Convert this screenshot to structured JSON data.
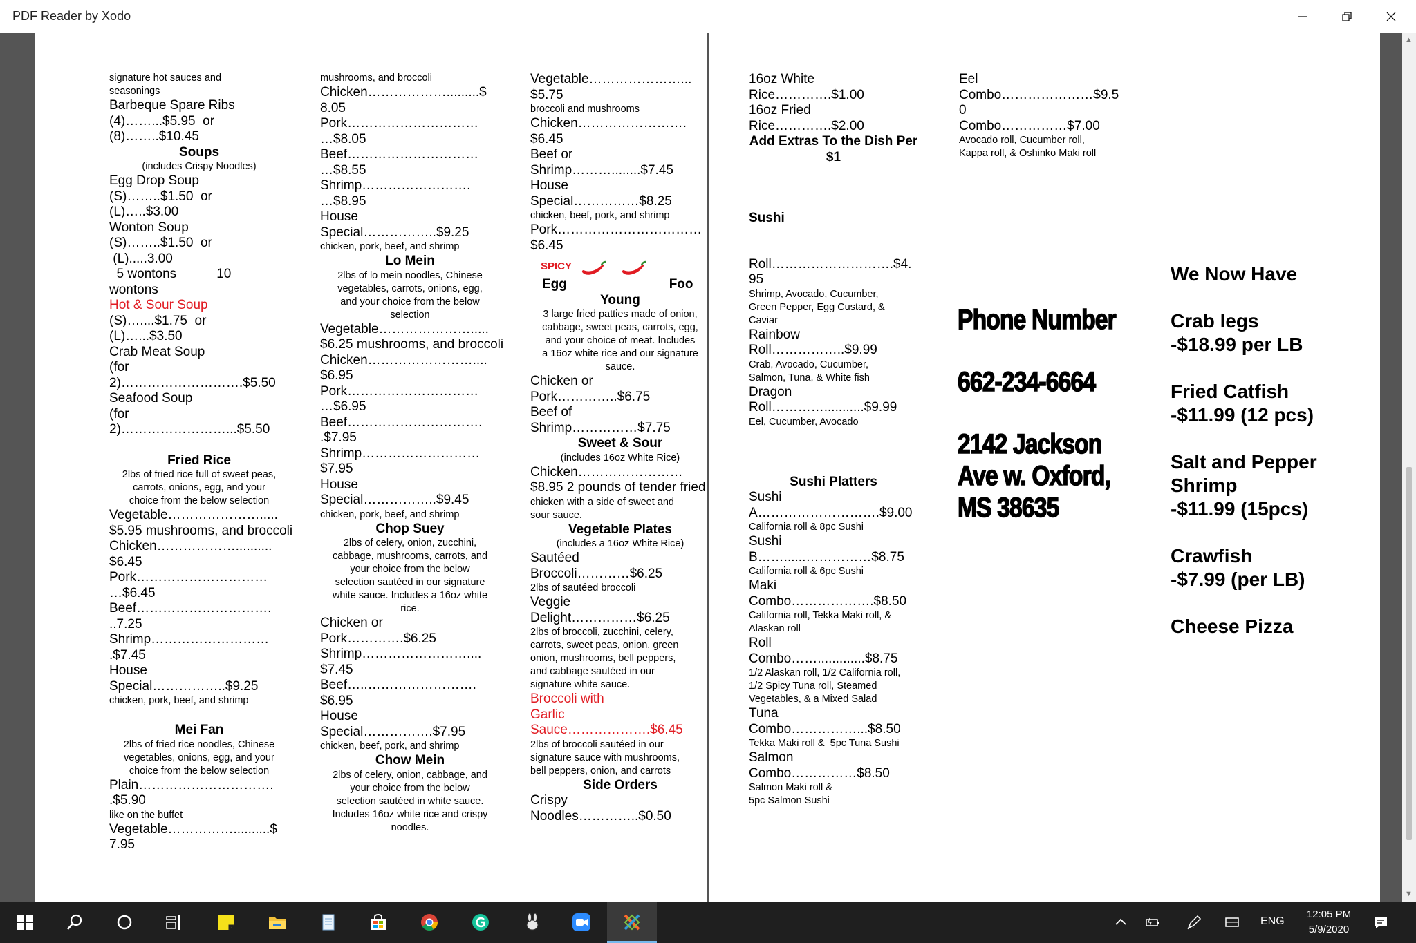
{
  "window": {
    "title": "PDF Reader by Xodo"
  },
  "left_page": {
    "col1": [
      [
        "s",
        "signature hot sauces and"
      ],
      [
        "s",
        "seasonings"
      ],
      [
        "n",
        "Barbeque Spare Ribs"
      ],
      [
        "n",
        "(4)……...$5.95  or"
      ],
      [
        "n",
        "(8)……..$10.45"
      ],
      [
        "h",
        "Soups"
      ],
      [
        "sc",
        "(includes Crispy Noodles)"
      ],
      [
        "n",
        "Egg Drop Soup"
      ],
      [
        "n",
        "(S)……..$1.50  or"
      ],
      [
        "n",
        "(L)…..$3.00"
      ],
      [
        "n",
        "Wonton Soup"
      ],
      [
        "n",
        "(S)……..$1.50  or"
      ],
      [
        "n",
        " (L).....3.00"
      ],
      [
        "n",
        "  5 wontons           10"
      ],
      [
        "n",
        "wontons"
      ],
      [
        "r",
        "Hot & Sour Soup"
      ],
      [
        "n",
        "(S)…....$1.75  or"
      ],
      [
        "n",
        "(L)…...$3.50"
      ],
      [
        "n",
        "Crab Meat Soup"
      ],
      [
        "n",
        "(for"
      ],
      [
        "n",
        "2)……………………….$5.50"
      ],
      [
        "n",
        "Seafood Soup"
      ],
      [
        "n",
        "(for"
      ],
      [
        "n",
        "2)……………………...$5.50"
      ],
      [
        "gap",
        ""
      ],
      [
        "h",
        "Fried Rice"
      ],
      [
        "sc",
        "2lbs of fried rice full of sweet peas,"
      ],
      [
        "sc",
        "carrots, onions, egg, and your"
      ],
      [
        "sc",
        "choice from the below selection"
      ],
      [
        "n",
        "Vegetable…………………....."
      ],
      [
        "n",
        "$5.95 mushrooms, and broccoli"
      ],
      [
        "n",
        "Chicken……………….........."
      ],
      [
        "n",
        "$6.45"
      ],
      [
        "n",
        "Pork…………………………"
      ],
      [
        "n",
        "…$6.45"
      ],
      [
        "n",
        "Beef…………………………."
      ],
      [
        "n",
        "..7.25"
      ],
      [
        "n",
        "Shrimp………………………"
      ],
      [
        "n",
        ".$7.45"
      ],
      [
        "n",
        "House"
      ],
      [
        "n",
        "Special……………..$9.25"
      ],
      [
        "s",
        "chicken, pork, beef, and shrimp"
      ],
      [
        "gap",
        ""
      ],
      [
        "h",
        "Mei Fan"
      ],
      [
        "sc",
        "2lbs of fried rice noodles, Chinese"
      ],
      [
        "sc",
        "vegetables, onions, egg, and your"
      ],
      [
        "sc",
        "choice from the below selection"
      ],
      [
        "n",
        "Plain…………………………."
      ],
      [
        "n",
        ".$5.90"
      ],
      [
        "s",
        "like on the buffet"
      ],
      [
        "n",
        "Vegetable……………..........$"
      ],
      [
        "n",
        "7.95"
      ]
    ],
    "col2": [
      [
        "s",
        "mushrooms, and broccoli"
      ],
      [
        "n",
        "Chicken……………….........$"
      ],
      [
        "n",
        "8.05"
      ],
      [
        "n",
        "Pork…………………………"
      ],
      [
        "n",
        "…$8.05"
      ],
      [
        "n",
        "Beef…………………………"
      ],
      [
        "n",
        "…$8.55"
      ],
      [
        "n",
        "Shrimp……………………."
      ],
      [
        "n",
        "…$8.95"
      ],
      [
        "n",
        "House"
      ],
      [
        "n",
        "Special……………..$9.25"
      ],
      [
        "s",
        "chicken, pork, beef, and shrimp"
      ],
      [
        "h",
        "Lo Mein"
      ],
      [
        "sc",
        "2lbs of lo mein noodles, Chinese"
      ],
      [
        "sc",
        "vegetables, carrots, onions, egg,"
      ],
      [
        "sc",
        "and your choice from the below"
      ],
      [
        "sc",
        "selection"
      ],
      [
        "n",
        "Vegetable…………………....."
      ],
      [
        "n",
        "$6.25 mushrooms, and broccoli"
      ],
      [
        "n",
        "Chicken……………………...."
      ],
      [
        "n",
        "$6.95"
      ],
      [
        "n",
        "Pork…………………………"
      ],
      [
        "n",
        "…$6.95"
      ],
      [
        "n",
        "Beef…………………………."
      ],
      [
        "n",
        ".$7.95"
      ],
      [
        "n",
        "Shrimp………………………"
      ],
      [
        "n",
        "$7.95"
      ],
      [
        "n",
        "House"
      ],
      [
        "n",
        "Special……………..$9.45"
      ],
      [
        "s",
        "chicken, pork, beef, and shrimp"
      ],
      [
        "h",
        "Chop Suey"
      ],
      [
        "sc",
        "2lbs of celery, onion, zucchini,"
      ],
      [
        "sc",
        "cabbage, mushrooms, carrots, and"
      ],
      [
        "sc",
        "your choice from the below"
      ],
      [
        "sc",
        "selection sautéed in our signature"
      ],
      [
        "sc",
        "white sauce. Includes a 16oz white"
      ],
      [
        "sc",
        "rice."
      ],
      [
        "n",
        "Chicken or"
      ],
      [
        "n",
        "Pork………….$6.25"
      ],
      [
        "n",
        "Shrimp……………………...."
      ],
      [
        "n",
        "$7.45"
      ],
      [
        "n",
        "Beef…..……………………."
      ],
      [
        "n",
        "$6.95"
      ],
      [
        "n",
        "House"
      ],
      [
        "n",
        "Special…………….$7.95"
      ],
      [
        "s",
        "chicken, beef, pork, and shrimp"
      ],
      [
        "h",
        "Chow Mein"
      ],
      [
        "sc",
        "2lbs of celery, onion, cabbage, and"
      ],
      [
        "sc",
        "your choice from the below"
      ],
      [
        "sc",
        "selection sautéed in white sauce."
      ],
      [
        "sc",
        "Includes 16oz white rice and crispy"
      ],
      [
        "sc",
        "noodles."
      ]
    ],
    "col3_top": [
      [
        "n",
        "Vegetable…………………..."
      ],
      [
        "n",
        "$5.75"
      ],
      [
        "s",
        "broccoli and mushrooms"
      ],
      [
        "n",
        "Chicken……………………."
      ],
      [
        "n",
        "$6.45"
      ],
      [
        "n",
        "Beef or"
      ],
      [
        "n",
        "Shrimp………........$7.45"
      ],
      [
        "n",
        "House"
      ],
      [
        "n",
        "Special……………$8.25"
      ],
      [
        "s",
        "chicken, beef, pork, and shrimp"
      ],
      [
        "n",
        "Pork……………………………"
      ],
      [
        "n",
        "$6.45"
      ]
    ],
    "spicy_label": "SPICY",
    "egg_foo_line": "Egg                            Foo",
    "col3_bottom": [
      [
        "h",
        "Young"
      ],
      [
        "sc",
        "3 large fried patties made of onion,"
      ],
      [
        "sc",
        "cabbage, sweet peas, carrots, egg,"
      ],
      [
        "sc",
        "and your choice of meat. Includes"
      ],
      [
        "sc",
        "a 16oz white rice and our signature"
      ],
      [
        "sc",
        "sauce."
      ],
      [
        "n",
        "Chicken or"
      ],
      [
        "n",
        "Pork…………..$6.75"
      ],
      [
        "n",
        "Beef of"
      ],
      [
        "n",
        "Shrimp……………$7.75"
      ],
      [
        "h",
        "Sweet & Sour"
      ],
      [
        "sc",
        "(includes 16oz White Rice)"
      ],
      [
        "n",
        "Chicken……………………"
      ],
      [
        "n",
        "$8.95 2 pounds of tender fried"
      ],
      [
        "s",
        "chicken with a side of sweet and"
      ],
      [
        "s",
        "sour sauce."
      ],
      [
        "h",
        "Vegetable Plates"
      ],
      [
        "sc",
        "(includes a 16oz White Rice)"
      ],
      [
        "n",
        "Sautéed"
      ],
      [
        "n",
        "Broccoli…………$6.25"
      ],
      [
        "s",
        "2lbs of sautéed broccoli"
      ],
      [
        "n",
        "Veggie"
      ],
      [
        "n",
        "Delight……………$6.25"
      ],
      [
        "s",
        "2lbs of broccoli, zucchini, celery,"
      ],
      [
        "s",
        "carrots, sweet peas, onion, green"
      ],
      [
        "s",
        "onion, mushrooms, bell peppers,"
      ],
      [
        "s",
        "and cabbage sautéed in our"
      ],
      [
        "s",
        "signature white sauce."
      ],
      [
        "r",
        "Broccoli with"
      ],
      [
        "r",
        "Garlic"
      ],
      [
        "rn",
        "Sauce……………….$6.45"
      ],
      [
        "s",
        "2lbs of broccoli sautéed in our"
      ],
      [
        "s",
        "signature sauce with mushrooms,"
      ],
      [
        "s",
        "bell peppers, onion, and carrots"
      ],
      [
        "h",
        "Side Orders"
      ],
      [
        "n",
        "Crispy"
      ],
      [
        "n",
        "Noodles…………..$0.50"
      ]
    ]
  },
  "right_page": {
    "col4": [
      [
        "n",
        "16oz White"
      ],
      [
        "n",
        "Rice………….$1.00"
      ],
      [
        "n",
        "16oz Fried"
      ],
      [
        "n",
        "Rice………….$2.00"
      ],
      [
        "h",
        "Add Extras To the Dish Per"
      ],
      [
        "h",
        "$1"
      ],
      [
        "gapL",
        ""
      ],
      [
        "gap",
        ""
      ],
      [
        "b",
        "Sushi"
      ],
      [
        "gapL",
        ""
      ],
      [
        "n",
        "Roll……………………….$4."
      ],
      [
        "n",
        "95"
      ],
      [
        "s",
        "Shrimp, Avocado, Cucumber,"
      ],
      [
        "s",
        "Green Pepper, Egg Custard, &"
      ],
      [
        "s",
        "Caviar"
      ],
      [
        "n",
        "Rainbow"
      ],
      [
        "n",
        "Roll……………..$9.99"
      ],
      [
        "s",
        "Crab, Avocado, Cucumber,"
      ],
      [
        "s",
        "Salmon, Tuna, & White fish"
      ],
      [
        "n",
        "Dragon"
      ],
      [
        "n",
        "Roll…………...........$9.99"
      ],
      [
        "s",
        "Eel, Cucumber, Avocado"
      ],
      [
        "gapL",
        ""
      ],
      [
        "gap",
        ""
      ],
      [
        "h",
        "Sushi Platters"
      ],
      [
        "n",
        "Sushi"
      ],
      [
        "n",
        "A……………………….$9.00"
      ],
      [
        "s",
        "California roll & 8pc Sushi"
      ],
      [
        "n",
        "Sushi"
      ],
      [
        "n",
        "B……......……………$8.75"
      ],
      [
        "s",
        "California roll & 6pc Sushi"
      ],
      [
        "n",
        "Maki"
      ],
      [
        "n",
        "Combo……………….$8.50"
      ],
      [
        "s",
        "California roll, Tekka Maki roll, &"
      ],
      [
        "s",
        "Alaskan roll"
      ],
      [
        "n",
        "Roll"
      ],
      [
        "n",
        "Combo…….............$8.75"
      ],
      [
        "s",
        "1/2 Alaskan roll, 1/2 California roll,"
      ],
      [
        "s",
        "1/2 Spicy Tuna roll, Steamed"
      ],
      [
        "s",
        "Vegetables, & a Mixed Salad"
      ],
      [
        "n",
        "Tuna"
      ],
      [
        "n",
        "Combo……………...$8.50"
      ],
      [
        "s",
        "Tekka Maki roll &  5pc Tuna Sushi"
      ],
      [
        "n",
        "Salmon"
      ],
      [
        "n",
        "Combo……………$8.50"
      ],
      [
        "s",
        "Salmon Maki roll &"
      ],
      [
        "s",
        "5pc Salmon Sushi"
      ]
    ],
    "col5": [
      [
        "n",
        "Eel"
      ],
      [
        "n",
        "Combo…………………$9.5"
      ],
      [
        "n",
        "0"
      ],
      [
        "n",
        "Combo……………$7.00"
      ],
      [
        "s",
        "Avocado roll, Cucumber roll,"
      ],
      [
        "s",
        "Kappa roll, & Oshinko Maki roll"
      ]
    ],
    "contact": [
      "Phone Number",
      "",
      "662-234-6664",
      "",
      "2142 Jackson",
      "Ave w. Oxford,",
      "MS 38635"
    ],
    "specials": [
      "We Now Have",
      "",
      "Crab legs",
      "-$18.99 per LB",
      "",
      "Fried Catfish",
      "-$11.99 (12 pcs)",
      "",
      "Salt and Pepper",
      "Shrimp",
      "-$11.99 (15pcs)",
      "",
      "Crawfish",
      "-$7.99 (per LB)",
      "",
      "Cheese Pizza"
    ]
  },
  "taskbar": {
    "language": "ENG",
    "time": "12:05 PM",
    "date": "5/9/2020",
    "icons": [
      "windows-start-icon",
      "search-icon",
      "cortana-icon",
      "task-view-icon",
      "sticky-notes-icon",
      "file-explorer-icon",
      "notepad-icon",
      "store-icon",
      "chrome-icon",
      "grammarly-icon",
      "rabbit-app-icon",
      "zoom-icon",
      "xodo-icon"
    ]
  },
  "colors": {
    "red": "#e11b22",
    "taskbar": "#1f1f1f",
    "viewer_bg": "#555555"
  }
}
